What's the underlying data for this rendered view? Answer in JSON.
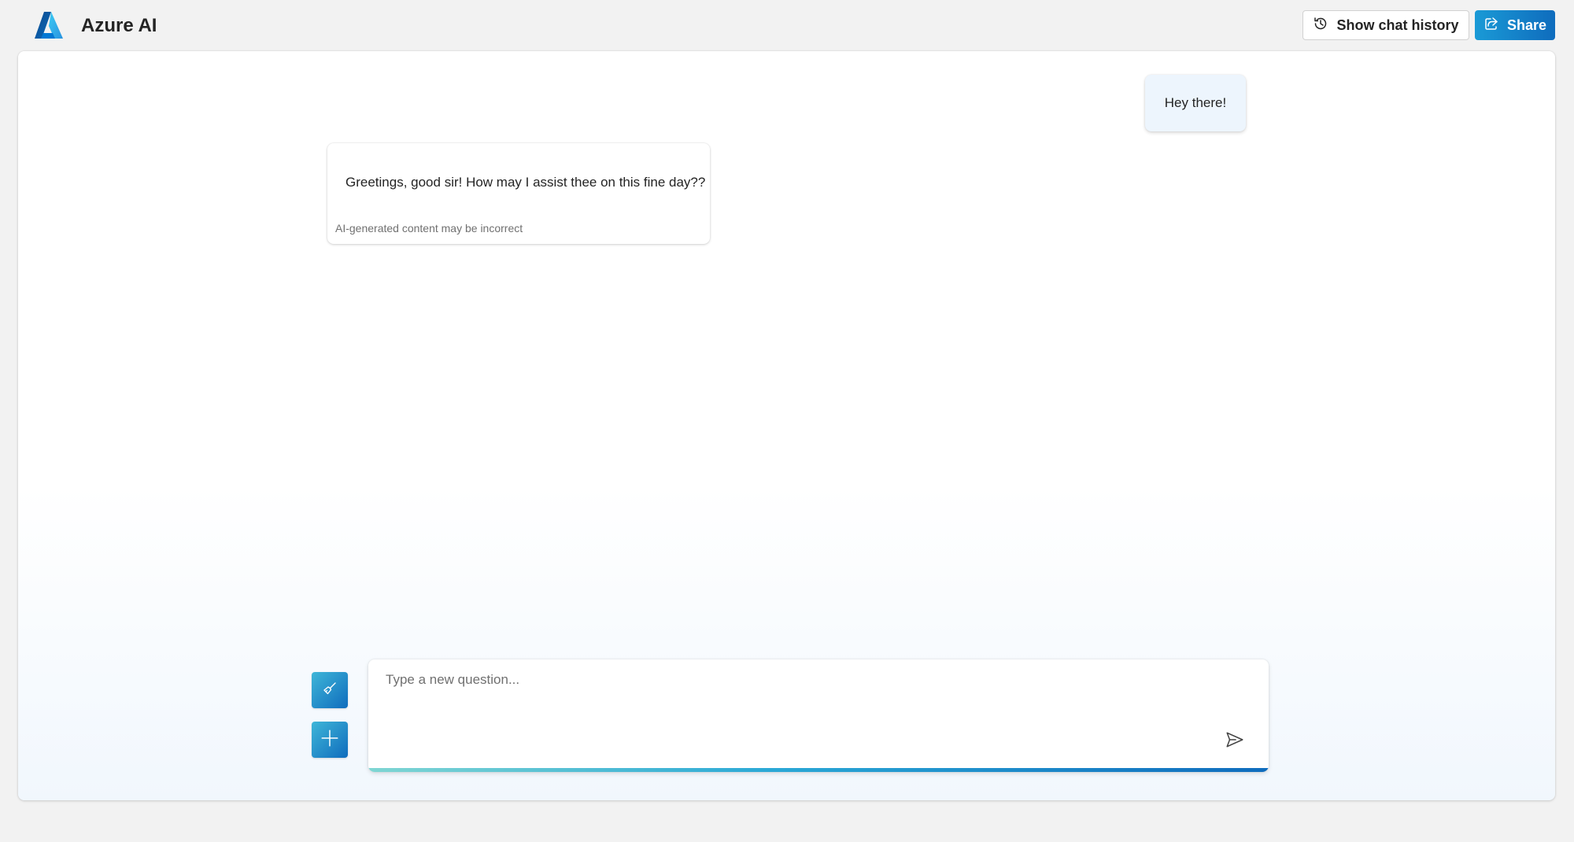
{
  "header": {
    "title": "Azure AI",
    "logo_icon": "azure-logo-icon",
    "history_button_label": "Show chat history",
    "history_icon": "history-icon",
    "share_button_label": "Share",
    "share_icon": "share-icon"
  },
  "conversation": {
    "messages": [
      {
        "role": "user",
        "text": "Hey there!"
      },
      {
        "role": "assistant",
        "text": "Greetings, good sir! How may I assist thee on this fine day??",
        "disclaimer": "AI-generated content may be incorrect"
      }
    ]
  },
  "actions": {
    "clear_chat_icon": "broom-icon",
    "new_chat_icon": "plus-icon"
  },
  "input": {
    "value": "",
    "placeholder": "Type a new question...",
    "send_icon": "send-icon"
  },
  "colors": {
    "accent": "#0f6cbd",
    "accent_light": "#1a9ad6",
    "user_bubble": "#edf5fd",
    "page_background": "#f2f2f2"
  }
}
